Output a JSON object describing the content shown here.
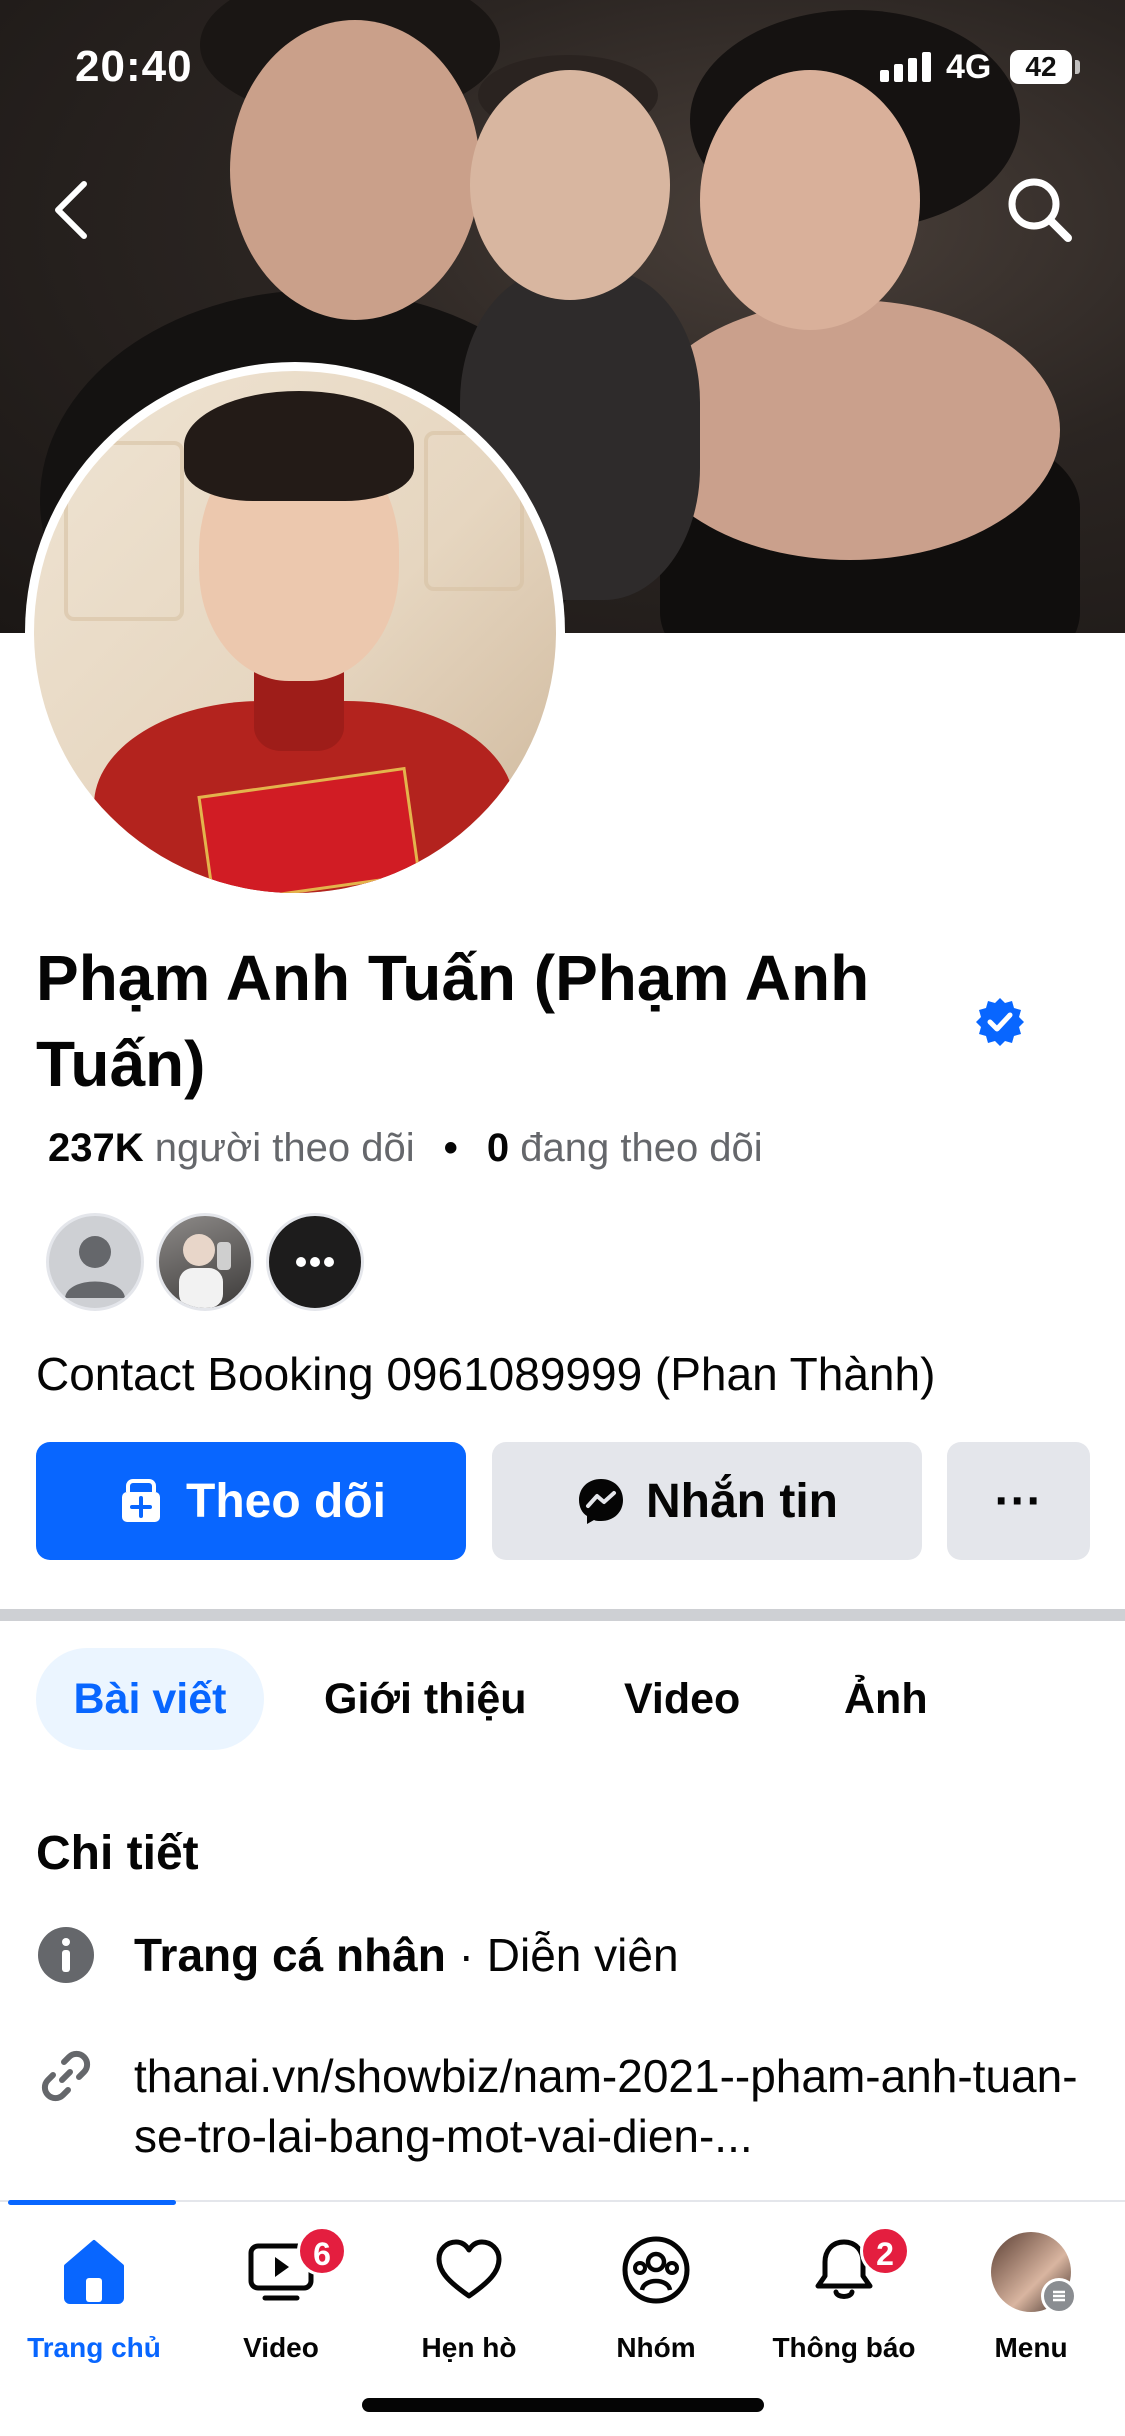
{
  "status_bar": {
    "time": "20:40",
    "network": "4G",
    "battery": "42"
  },
  "profile": {
    "name": "Phạm Anh Tuấn (Phạm Anh Tuấn)",
    "followers_count": "237K",
    "followers_label": "người theo dõi",
    "separator": "•",
    "following_count": "0",
    "following_label": "đang theo dõi",
    "bio": "Contact Booking 0961089999 (Phan Thành)"
  },
  "actions": {
    "follow_label": "Theo dõi",
    "message_label": "Nhắn tin",
    "more_label": "···"
  },
  "tabs": [
    {
      "label": "Bài viết",
      "active": true
    },
    {
      "label": "Giới thiệu",
      "active": false
    },
    {
      "label": "Video",
      "active": false
    },
    {
      "label": "Ảnh",
      "active": false
    }
  ],
  "details": {
    "heading": "Chi tiết",
    "category_label": "Trang cá nhân",
    "category_sep": " · ",
    "category_value": "Diễn viên",
    "link": "thanai.vn/showbiz/nam-2021--pham-anh-tuan-se-tro-lai-bang-mot-vai-dien-..."
  },
  "bottom_nav": [
    {
      "label": "Trang chủ",
      "icon": "home-icon",
      "active": true
    },
    {
      "label": "Video",
      "icon": "video-icon",
      "badge": "6"
    },
    {
      "label": "Hẹn hò",
      "icon": "heart-icon"
    },
    {
      "label": "Nhóm",
      "icon": "groups-icon"
    },
    {
      "label": "Thông báo",
      "icon": "bell-icon",
      "badge": "2"
    },
    {
      "label": "Menu",
      "icon": "avatar"
    }
  ],
  "colors": {
    "accent": "#0866ff",
    "badge": "#e41e3f",
    "button_secondary": "#e4e6eb",
    "text_secondary": "#65676b",
    "verified": "#0866ff"
  }
}
